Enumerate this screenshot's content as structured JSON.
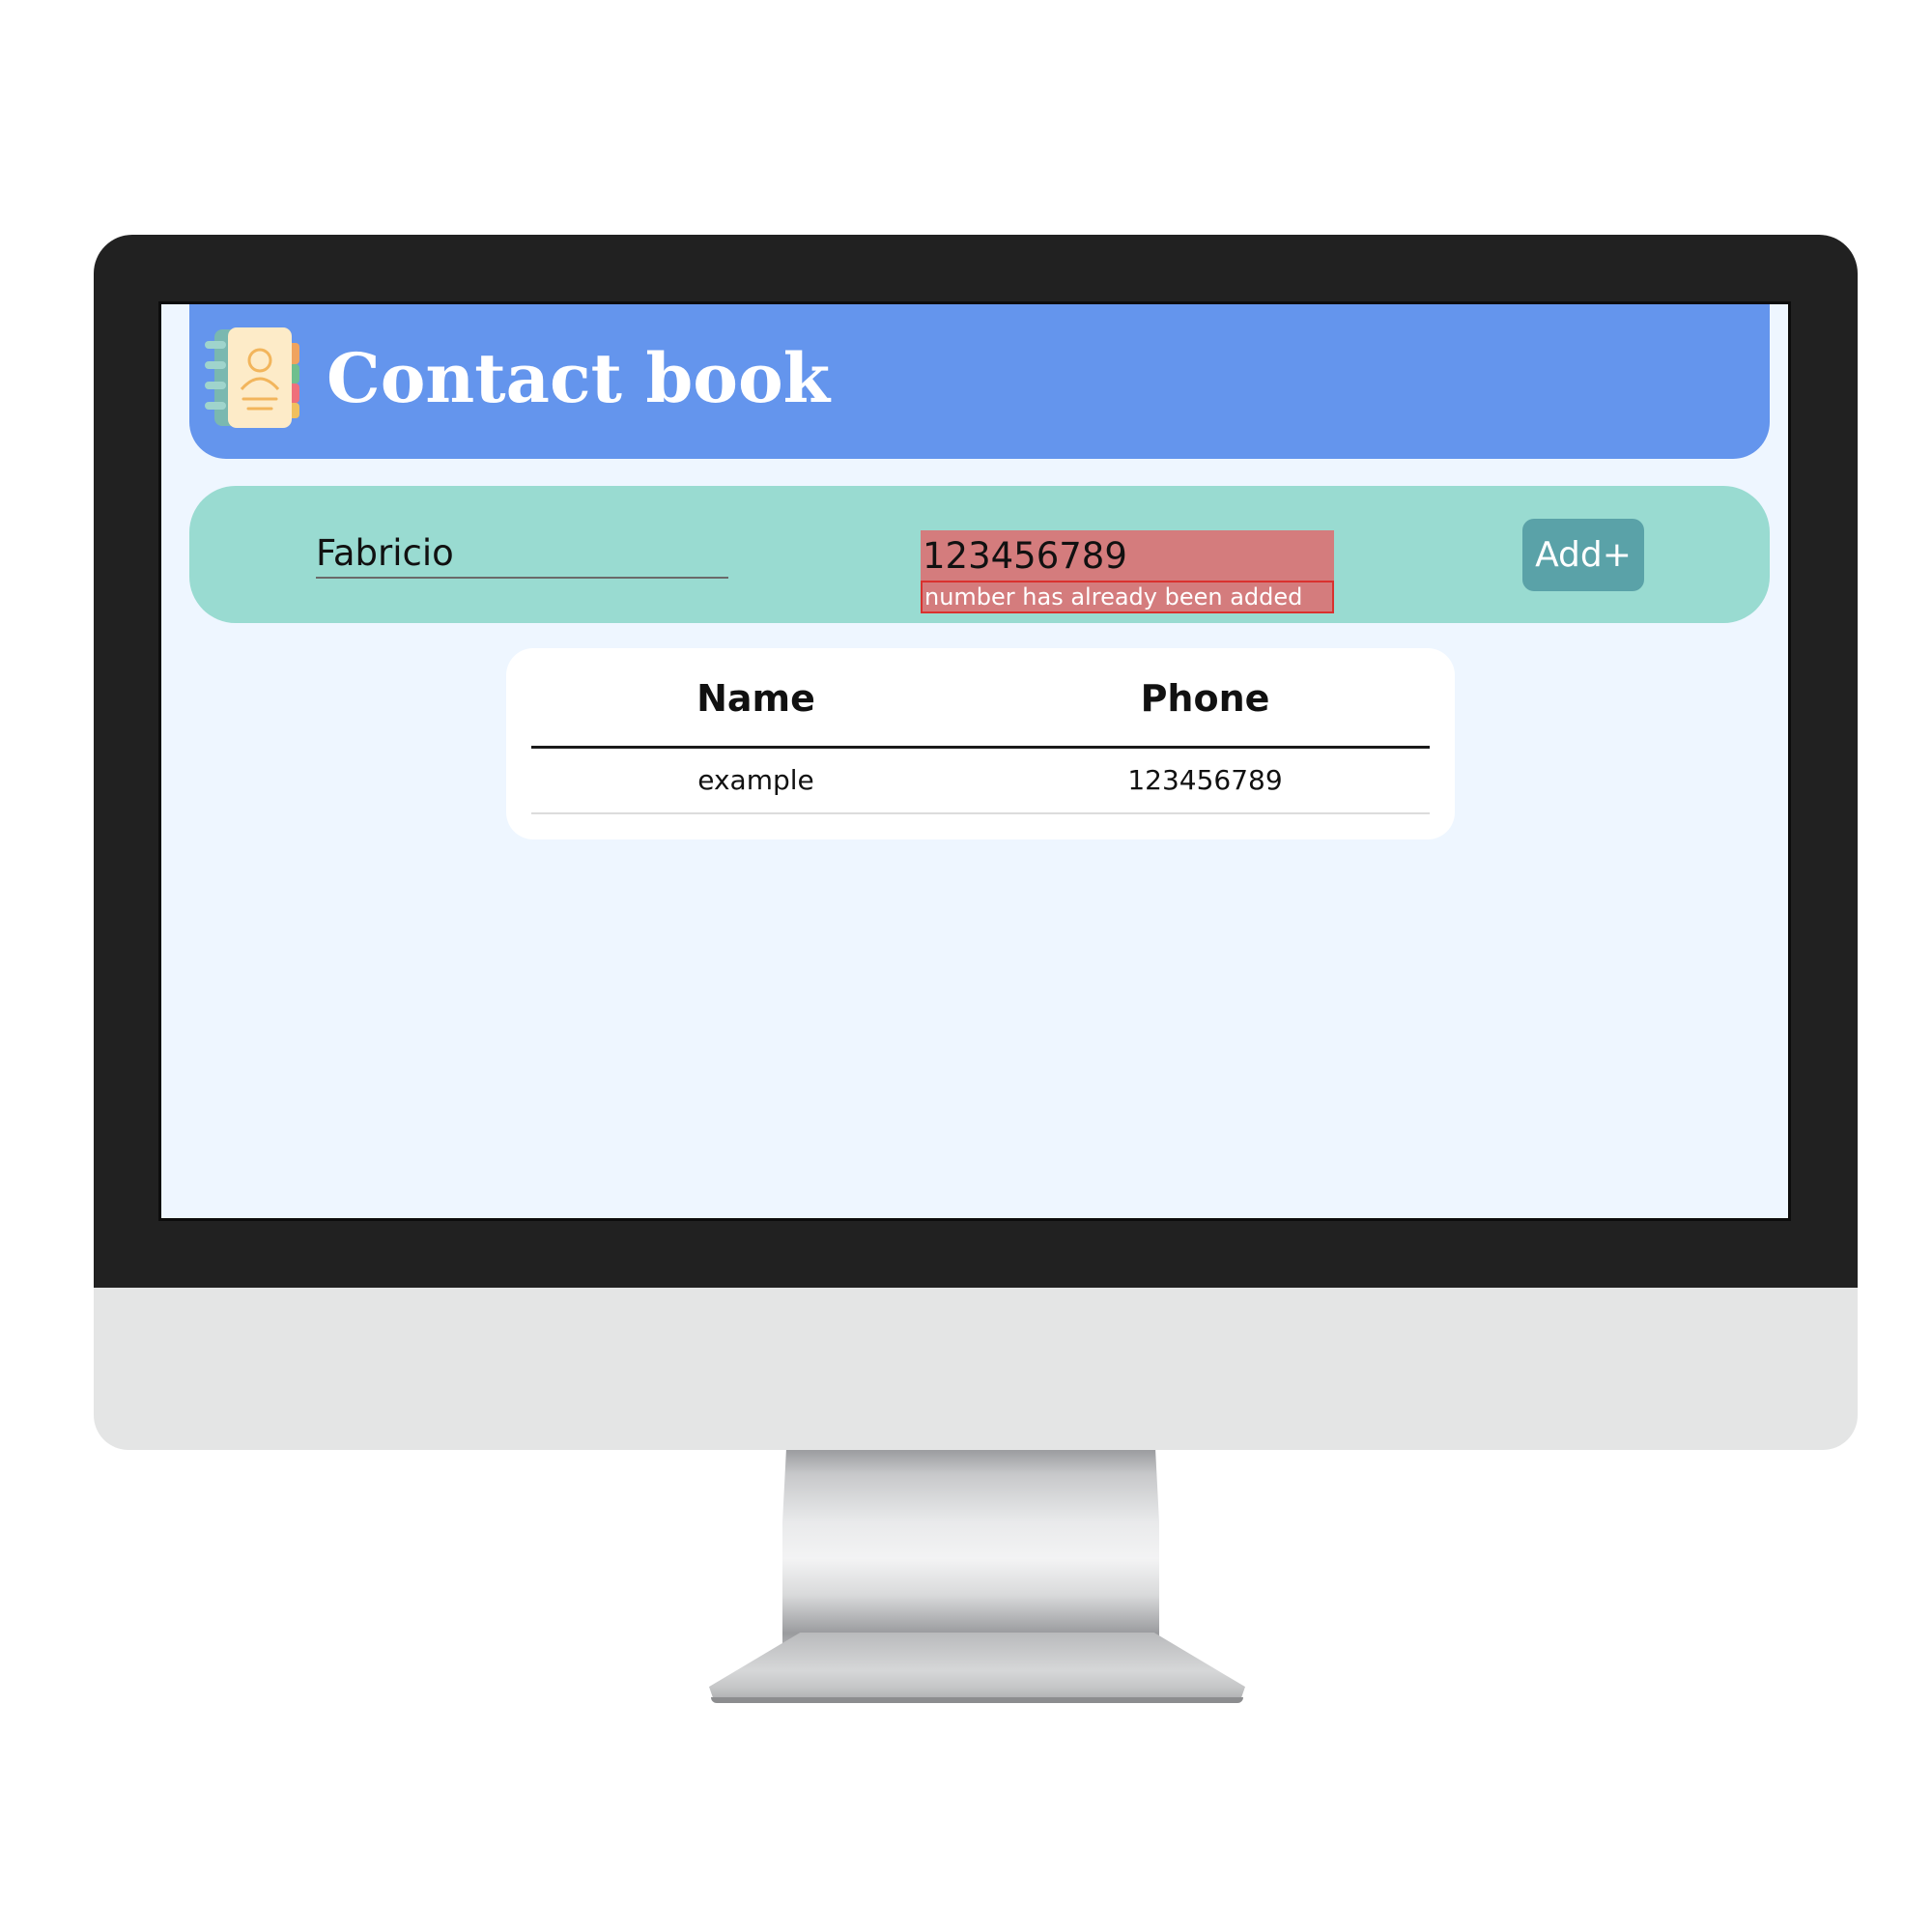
{
  "app": {
    "title": "Contact book",
    "logo_icon": "contact-book-icon"
  },
  "form": {
    "name_value": "Fabricio",
    "phone_value": "123456789",
    "phone_error": "number has already been added",
    "add_button_label": "Add+"
  },
  "table": {
    "headers": [
      "Name",
      "Phone"
    ],
    "rows": [
      {
        "name": "example",
        "phone": "123456789"
      }
    ]
  },
  "colors": {
    "header_bg": "#6495ed",
    "form_bg": "#99dbd1",
    "error_bg": "#d47c7d",
    "error_border": "#d9322f",
    "button_bg": "#5aa2a8",
    "screen_bg": "#eef6ff"
  }
}
